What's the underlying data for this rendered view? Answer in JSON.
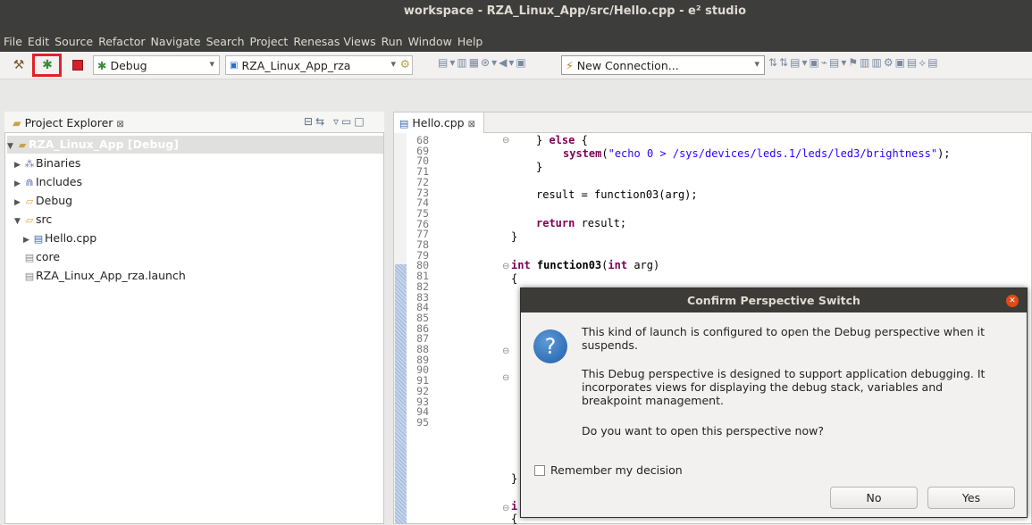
{
  "window": {
    "title": "workspace - RZA_Linux_App/src/Hello.cpp - e² studio"
  },
  "menu": [
    "File",
    "Edit",
    "Source",
    "Refactor",
    "Navigate",
    "Search",
    "Project",
    "Renesas Views",
    "Run",
    "Window",
    "Help"
  ],
  "toolbar": {
    "build_icon": "hammer-icon",
    "debug_icon": "bug-icon",
    "stop_icon": "stop-icon",
    "launch_mode": "Debug",
    "launch_config": "RZA_Linux_App_rza",
    "connection": "New Connection..."
  },
  "explorer": {
    "tab_label": "Project Explorer",
    "tab_close": "⊠",
    "items": [
      {
        "label": "RZA_Linux_App [Debug]",
        "icon": "project-icon"
      },
      {
        "label": "Binaries",
        "icon": "binaries-icon"
      },
      {
        "label": "Includes",
        "icon": "includes-icon"
      },
      {
        "label": "Debug",
        "icon": "folder-icon"
      },
      {
        "label": "src",
        "icon": "folder-icon"
      },
      {
        "label": "Hello.cpp",
        "icon": "cpp-file-icon"
      },
      {
        "label": "core",
        "icon": "file-icon"
      },
      {
        "label": "RZA_Linux_App_rza.launch",
        "icon": "file-icon"
      }
    ]
  },
  "editor": {
    "tab_label": "Hello.cpp",
    "tab_close": "⊠",
    "line_numbers": [
      "68",
      "69",
      "70",
      "71",
      "72",
      "73",
      "74",
      "75",
      "76",
      "77",
      "78",
      "79",
      "80",
      "81",
      "82",
      "83",
      "84",
      "85",
      "86",
      "87",
      "88",
      "89",
      "90",
      "91",
      "92",
      "93",
      "94",
      "95"
    ],
    "code": {
      "l68_a": "} ",
      "l68_kw": "else",
      "l68_b": " {",
      "l69_kw": "system",
      "l69_a": "(",
      "l69_str": "\"echo 0 > /sys/devices/leds.1/leds/led3/brightness\"",
      "l69_b": ");",
      "l70": "}",
      "l72": "result = function03(arg);",
      "l74_kw": "return",
      "l74_a": " result;",
      "l75": "}",
      "l77_kw1": "int",
      "l77_fn": " function03",
      "l77_a": "(",
      "l77_kw2": "int",
      "l77_b": " arg)",
      "l78": "{",
      "l92": "}",
      "l94": "i",
      "l95": "{"
    }
  },
  "dialog": {
    "title": "Confirm Perspective Switch",
    "message1": "This kind of launch is configured to open the Debug perspective when it suspends.",
    "message2": "This Debug perspective is designed to support application debugging.  It incorporates views for displaying the debug stack, variables and breakpoint management.",
    "message3": "Do you want to open this perspective now?",
    "remember_label": "Remember my decision",
    "remember_checked": false,
    "no_label": "No",
    "yes_label": "Yes"
  }
}
